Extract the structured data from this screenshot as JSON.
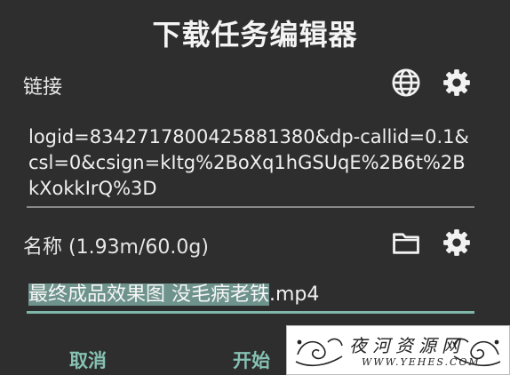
{
  "dialog": {
    "title": "下载任务编辑器",
    "link_section": {
      "label": "链接",
      "url": "logid=8342717800425881380&dp-callid=0.1&csl=0&csign=kItg%2BoXq1hGSUqE%2B6t%2BkXokkIrQ%3D"
    },
    "name_section": {
      "label": "名称 (1.93m/60.0g)",
      "filename_selected": "最终成品效果图 没毛病老铁",
      "filename_ext": ".mp4"
    },
    "buttons": {
      "cancel": "取消",
      "start": "开始"
    }
  },
  "icons": [
    "globe-icon",
    "gear-icon",
    "folder-icon",
    "gear-icon"
  ],
  "watermark": {
    "text": "夜河资源网",
    "url": "WWW.YEHES.COM"
  },
  "colors": {
    "background": "#2e2e2e",
    "accent": "#86c1b3",
    "selection": "#6e938c"
  }
}
